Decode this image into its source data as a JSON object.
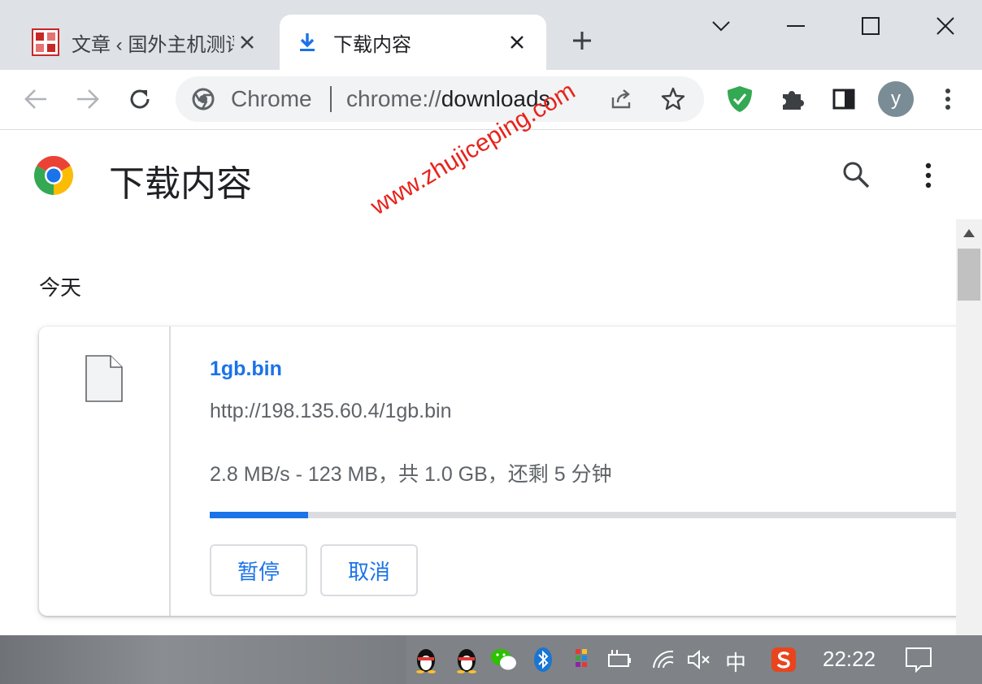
{
  "tabs": [
    {
      "title": "文章 ‹ 国外主机测评",
      "active": false,
      "favicon": "site-seal-icon"
    },
    {
      "title": "下载内容",
      "active": true,
      "favicon": "download-icon"
    }
  ],
  "window_controls": [
    "minimize",
    "maximize",
    "close"
  ],
  "omnibox": {
    "origin": "Chrome",
    "url_scheme": "chrome://",
    "url_host": "downloads"
  },
  "avatar_letter": "y",
  "page": {
    "title": "下载内容"
  },
  "downloads": {
    "date_heading": "今天",
    "item": {
      "file_name": "1gb.bin",
      "url": "http://198.135.60.4/1gb.bin",
      "status": "2.8 MB/s - 123 MB，共 1.0 GB，还剩 5 分钟",
      "progress_fraction": 0.123,
      "pause_label": "暂停",
      "cancel_label": "取消"
    }
  },
  "watermark": "www.zhujiceping.com",
  "taskbar": {
    "ime": "中",
    "clock": "22:22"
  },
  "colors": {
    "accent": "#1a73e8",
    "tabstrip": "#dee1e6",
    "watermark": "#e8221b",
    "shield": "#34a853"
  }
}
